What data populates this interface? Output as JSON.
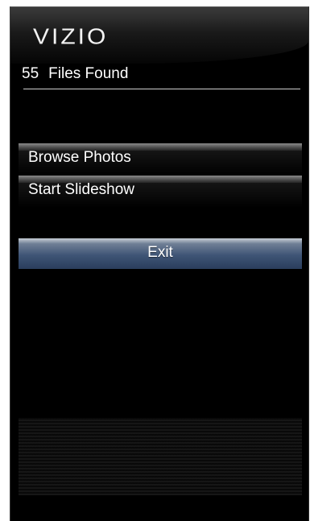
{
  "brand": {
    "logo_text": "VIZIO"
  },
  "summary": {
    "count": "55",
    "label": "Files Found"
  },
  "menu": {
    "items": [
      {
        "label": "Browse Photos"
      },
      {
        "label": "Start Slideshow"
      }
    ],
    "exit_label": "Exit"
  },
  "colors": {
    "background": "#000000",
    "text": "#ffffff",
    "exit_button": "#3f5576"
  }
}
